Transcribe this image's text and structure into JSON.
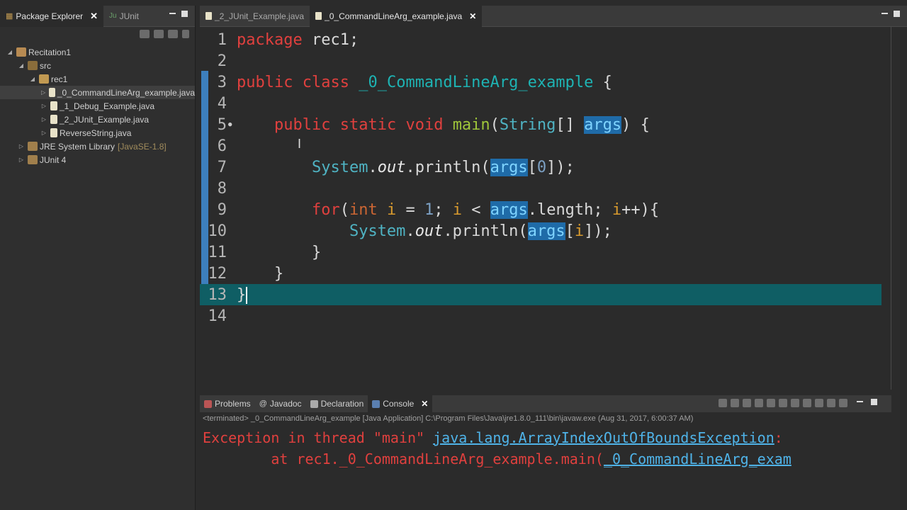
{
  "left_panel": {
    "tabs": [
      {
        "label": "Package Explorer",
        "active": true
      },
      {
        "label": "JUnit",
        "active": false
      }
    ],
    "tree": [
      {
        "label": "Recitation1",
        "indent": 0,
        "icon": "project-icon"
      },
      {
        "label": "src",
        "indent": 1,
        "icon": "package-folder-icon"
      },
      {
        "label": "rec1",
        "indent": 2,
        "icon": "package-icon"
      },
      {
        "label": "_0_CommandLineArg_example.java",
        "indent": 3,
        "icon": "java-file-icon",
        "selected": true
      },
      {
        "label": "_1_Debug_Example.java",
        "indent": 3,
        "icon": "java-file-icon"
      },
      {
        "label": "_2_JUnit_Example.java",
        "indent": 3,
        "icon": "java-file-icon"
      },
      {
        "label": "ReverseString.java",
        "indent": 3,
        "icon": "java-file-icon"
      },
      {
        "label": "JRE System Library",
        "tag": "[JavaSE-1.8]",
        "indent": 1,
        "icon": "library-icon"
      },
      {
        "label": "JUnit 4",
        "indent": 1,
        "icon": "library-icon"
      }
    ]
  },
  "editor": {
    "tabs": [
      {
        "label": "_2_JUnit_Example.java",
        "active": false
      },
      {
        "label": "_0_CommandLineArg_example.java",
        "active": true
      }
    ],
    "line_numbers": [
      "1",
      "2",
      "3",
      "4",
      "5",
      "6",
      "7",
      "8",
      "9",
      "10",
      "11",
      "12",
      "13",
      "14"
    ]
  },
  "console": {
    "tabs": [
      {
        "label": "Problems",
        "active": false
      },
      {
        "label": "Javadoc",
        "active": false
      },
      {
        "label": "Declaration",
        "active": false
      },
      {
        "label": "Console",
        "active": true
      }
    ],
    "terminated": "<terminated> _0_CommandLineArg_example [Java Application] C:\\Program Files\\Java\\jre1.8.0_111\\bin\\javaw.exe (Aug 31, 2017, 6:00:37 AM)",
    "line1_prefix": "Exception in thread \"main\" ",
    "line1_link": "java.lang.ArrayIndexOutOfBoundsException",
    "line1_suffix": ": ",
    "line2_prefix": "        at rec1._0_CommandLineArg_example.main(",
    "line2_link": "_0_CommandLineArg_exam"
  }
}
